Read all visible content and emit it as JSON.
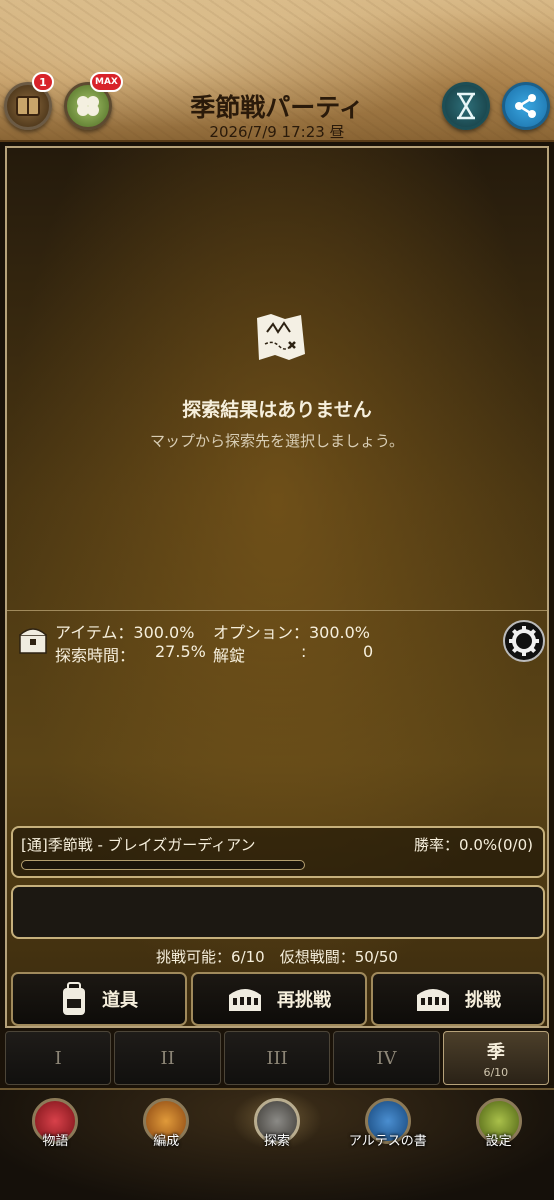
{
  "header": {
    "title": "季節戦パーティ",
    "datetime": "2026/7/9  17:23  昼",
    "badges": {
      "book": "1",
      "clover": "MAX"
    }
  },
  "explore": {
    "empty_title": "探索結果はありません",
    "empty_subtitle": "マップから探索先を選択しましょう。"
  },
  "stats": {
    "item_label": "アイテム：300.0%",
    "option_label": "オプション：300.0%",
    "time_label": "探索時間：",
    "time_value": "27.5%",
    "unlock_label": "解錠",
    "unlock_sep": ":",
    "unlock_value": "0"
  },
  "battle": {
    "name": "[通]季節戦 - ブレイズガーディアン",
    "win_rate": "勝率：0.0%(0/0)",
    "progress": 0
  },
  "counts": "挑戦可能：6/10　仮想戦闘：50/50",
  "actions": {
    "items": "道具",
    "retry": "再挑戦",
    "challenge": "挑戦"
  },
  "tabs": {
    "t1": "I",
    "t2": "II",
    "t3": "III",
    "t4": "IV",
    "t5": "季",
    "t5_count": "6/10"
  },
  "nav": {
    "story": "物語",
    "formation": "編成",
    "explore": "探索",
    "book": "アルテスの書",
    "settings": "設定"
  }
}
